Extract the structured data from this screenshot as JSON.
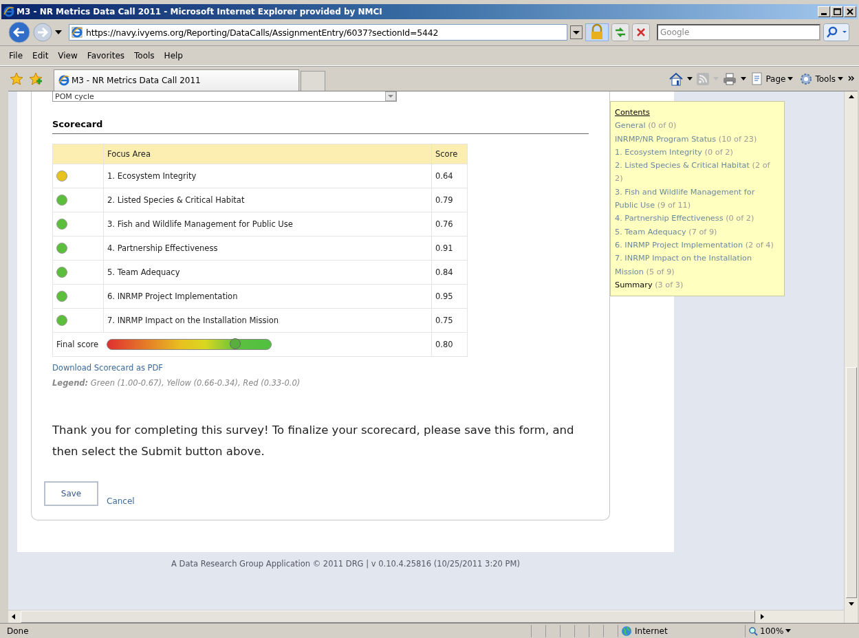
{
  "window": {
    "title": "M3 - NR Metrics Data Call 2011 - Microsoft Internet Explorer provided by NMCI"
  },
  "address_bar": {
    "url": "https://navy.ivyems.org/Reporting/DataCalls/AssignmentEntry/6037?sectionId=5442",
    "search_placeholder": "Google"
  },
  "menu": [
    "File",
    "Edit",
    "View",
    "Favorites",
    "Tools",
    "Help"
  ],
  "tabs": [
    {
      "label": "M3 - NR Metrics Data Call 2011",
      "selected": true
    }
  ],
  "command_bar": [
    "Page",
    "Tools"
  ],
  "page": {
    "dropdown_value": "POM cycle",
    "scorecard": {
      "title": "Scorecard",
      "columns": [
        "Focus Area",
        "Score"
      ],
      "rows": [
        {
          "color": "#e8c21e",
          "area": "1. Ecosystem Integrity",
          "score": "0.64"
        },
        {
          "color": "#5cbf3c",
          "area": "2. Listed Species & Critical Habitat",
          "score": "0.79"
        },
        {
          "color": "#5cbf3c",
          "area": "3. Fish and Wildlife Management for Public Use",
          "score": "0.76"
        },
        {
          "color": "#5cbf3c",
          "area": "4. Partnership Effectiveness",
          "score": "0.91"
        },
        {
          "color": "#5cbf3c",
          "area": "5. Team Adequacy",
          "score": "0.84"
        },
        {
          "color": "#5cbf3c",
          "area": "6. INRMP Project Implementation",
          "score": "0.95"
        },
        {
          "color": "#5cbf3c",
          "area": "7. INRMP Impact on the Installation Mission",
          "score": "0.75"
        }
      ],
      "final": {
        "label": "Final score",
        "level": 0.78,
        "score": "0.80"
      },
      "download_link": "Download Scorecard as PDF",
      "legend": "**Legend:** Green (1.00-0.67), Yellow (0.66-0.34), Red (0.33-0.0)"
    },
    "message": "Thank you for completing this survey! To finalize your scorecard, please save this form, and then select the Submit button above.",
    "save_button": "Save",
    "cancel_link": "Cancel",
    "contents": {
      "title": "Contents",
      "items": [
        {
          "label": "General",
          "count": "(0 of 0)",
          "selected": false
        },
        {
          "label": "INRMP/NR Program Status",
          "count": "(10 of 23)",
          "selected": false
        },
        {
          "label": "1. Ecosystem Integrity",
          "count": "(0 of 2)",
          "selected": false
        },
        {
          "label": "2. Listed Species & Critical Habitat",
          "count": "(2 of 2)",
          "selected": false
        },
        {
          "label": "3. Fish and Wildlife Management for Public Use",
          "count": "(9 of 11)",
          "selected": false
        },
        {
          "label": "4. Partnership Effectiveness",
          "count": "(0 of 2)",
          "selected": false
        },
        {
          "label": "5. Team Adequacy",
          "count": "(7 of 9)",
          "selected": false
        },
        {
          "label": "6. INRMP Project Implementation",
          "count": "(2 of 4)",
          "selected": false
        },
        {
          "label": "7. INRMP Impact on the Installation Mission",
          "count": "(5 of 9)",
          "selected": false
        },
        {
          "label": "Summary",
          "count": "(3 of 3)",
          "selected": true
        }
      ]
    },
    "footer": "A Data Research Group Application © 2011 DRG | v 0.10.4.25816 (10/25/2011 3:20 PM)"
  },
  "status_bar": {
    "text": "Done",
    "zone": "Internet",
    "zoom": "100%"
  }
}
